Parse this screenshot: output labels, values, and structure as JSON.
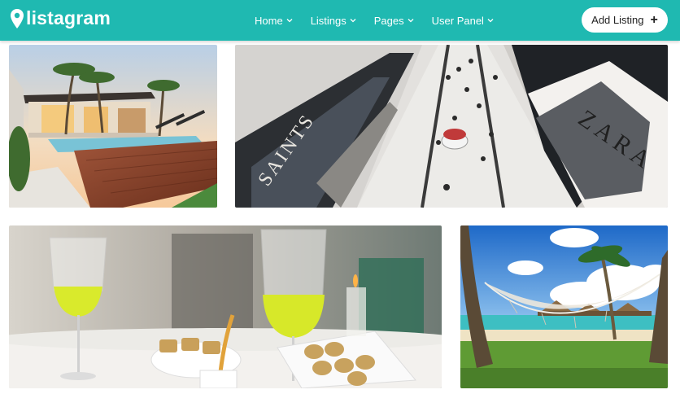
{
  "header": {
    "brand": "listagram",
    "nav": [
      {
        "label": "Home"
      },
      {
        "label": "Listings"
      },
      {
        "label": "Pages"
      },
      {
        "label": "User Panel"
      }
    ],
    "add_listing_label": "Add Listing"
  },
  "gallery": {
    "mall_signs": {
      "sign_left": "SAINTS",
      "sign_right": "ZARA"
    }
  },
  "colors": {
    "brand": "#1fb9b1"
  }
}
